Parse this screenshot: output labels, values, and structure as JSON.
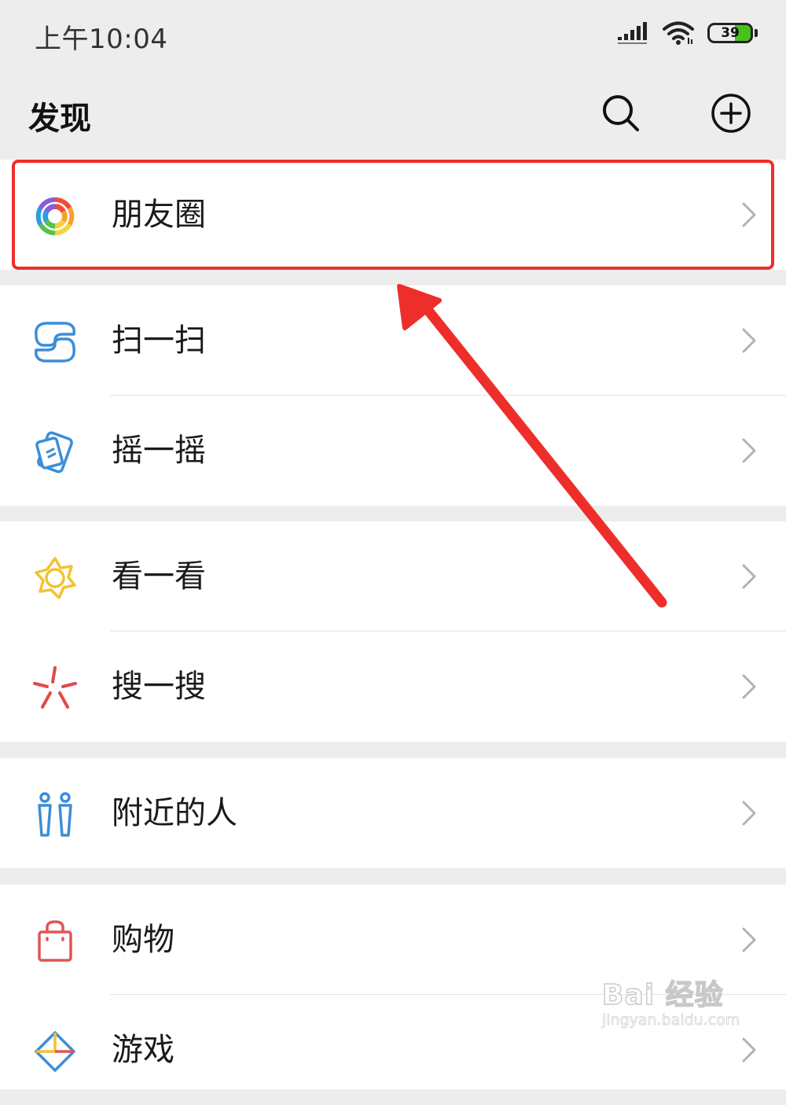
{
  "status_bar": {
    "time": "上午10:04",
    "battery": "39",
    "icons": [
      "signal-icon",
      "wifi-icon",
      "battery-icon"
    ]
  },
  "nav": {
    "title": "发现",
    "icons": [
      "search-icon",
      "plus-circle-icon"
    ]
  },
  "menu": {
    "moments": "朋友圈",
    "scan": "扫一扫",
    "shake": "摇一摇",
    "top_stories": "看一看",
    "search": "搜一搜",
    "people_nearby": "附近的人",
    "shopping": "购物",
    "games": "游戏"
  },
  "menu_icons": {
    "moments": "aperture-icon",
    "scan": "scan-icon",
    "shake": "shake-icon",
    "top_stories": "star-icon",
    "search": "spark-icon",
    "people_nearby": "people-icon",
    "shopping": "shopping-bag-icon",
    "games": "game-icon"
  },
  "colors": {
    "background": "#ededed",
    "card": "#ffffff",
    "highlight": "#ee2e2a",
    "scan_icon": "#3b8ed8",
    "top_stories_icon": "#f2c230",
    "search_icon": "#e04a4a",
    "shopping_icon": "#e05555"
  },
  "watermark": {
    "brand": "Bai 经验",
    "url": "jingyan.baidu.com"
  }
}
